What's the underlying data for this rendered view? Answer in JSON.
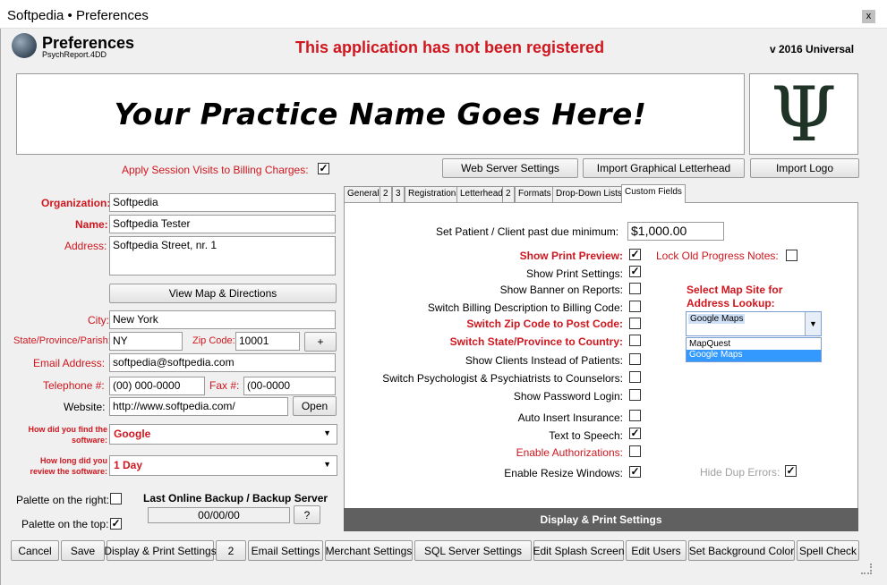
{
  "window": {
    "title": "Softpedia  • Preferences",
    "close": "x"
  },
  "header": {
    "title": "Preferences",
    "subtitle": "PsychReport.4DD",
    "warning": "This application has not been registered",
    "version": "v 2016 Universal"
  },
  "banner": {
    "text": "Your Practice Name Goes Here!",
    "logo_glyph": "Ψ"
  },
  "left": {
    "apply_session_label": "Apply Session Visits to Billing Charges:",
    "apply_session_checked": "✓",
    "organization_label": "Organization:",
    "organization_value": "Softpedia",
    "name_label": "Name:",
    "name_value": "Softpedia Tester",
    "address_label": "Address:",
    "address_value": "Softpedia Street, nr. 1",
    "view_map_button": "View Map & Directions",
    "city_label": "City:",
    "city_value": "New York",
    "state_label": "State/Province/Parish:",
    "state_value": "NY",
    "zip_label": "Zip Code:",
    "zip_value": "10001",
    "plus_button": "+",
    "email_label": "Email Address:",
    "email_value": "softpedia@softpedia.com",
    "telephone_label": "Telephone #:",
    "telephone_value": "(00) 000-0000",
    "fax_label": "Fax #:",
    "fax_value": "(00-0000",
    "website_label": "Website:",
    "website_value": "http://www.softpedia.com/",
    "open_button": "Open",
    "find_label_1": "How did you find the",
    "find_label_2": "software:",
    "find_value": "Google",
    "review_label_1": "How long did you",
    "review_label_2": "review the software:",
    "review_value": "1 Day",
    "palette_right_label": "Palette on the right:",
    "palette_top_label": "Palette on the top:",
    "palette_top_checked": "✓",
    "backup_label": "Last Online Backup / Backup Server",
    "backup_value": "00/00/00",
    "help_button": "?"
  },
  "top_buttons": {
    "web_server": "Web Server Settings",
    "import_letterhead": "Import Graphical Letterhead",
    "import_logo": "Import Logo"
  },
  "tabs": [
    "General",
    "2",
    "3",
    "Registration",
    "Letterhead",
    "2",
    "Formats",
    "Drop-Down Lists",
    "Custom Fields"
  ],
  "panel": {
    "past_due_label": "Set Patient / Client past due minimum:",
    "past_due_value": "$1,000.00",
    "options": [
      {
        "label": "Show Print Preview:",
        "checked": "✓"
      },
      {
        "label": "Show Print Settings:",
        "checked": "✓"
      },
      {
        "label": "Show Banner on Reports:",
        "checked": ""
      },
      {
        "label": "Switch Billing Description to Billing Code:",
        "checked": ""
      },
      {
        "label": "Switch Zip Code to Post Code:",
        "checked": ""
      },
      {
        "label": "Switch State/Province to Country:",
        "checked": ""
      },
      {
        "label": "Show Clients Instead of Patients:",
        "checked": ""
      },
      {
        "label": "Switch Psychologist & Psychiatrists to Counselors:",
        "checked": ""
      },
      {
        "label": "Show Password Login:",
        "checked": ""
      },
      {
        "label": "Auto Insert Insurance:",
        "checked": ""
      },
      {
        "label": "Text to Speech:",
        "checked": "✓"
      },
      {
        "label": "Enable Authorizations:",
        "checked": ""
      },
      {
        "label": "Enable Resize Windows:",
        "checked": "✓"
      }
    ],
    "lock_notes_label": "Lock Old Progress Notes:",
    "map_site_label_1": "Select Map Site for",
    "map_site_label_2": "Address Lookup:",
    "map_selected": "Google Maps",
    "map_options": [
      "MapQuest",
      "Google Maps"
    ],
    "hide_dup_label": "Hide Dup Errors:",
    "hide_dup_checked": "✓",
    "footer": "Display & Print Settings"
  },
  "bottom_buttons": [
    "Cancel",
    "Save",
    "Display & Print Settings",
    "2",
    "Email Settings",
    "Merchant Settings",
    "SQL Server Settings",
    "Edit Splash Screen",
    "Edit Users",
    "Set Background Color",
    "Spell Check"
  ]
}
